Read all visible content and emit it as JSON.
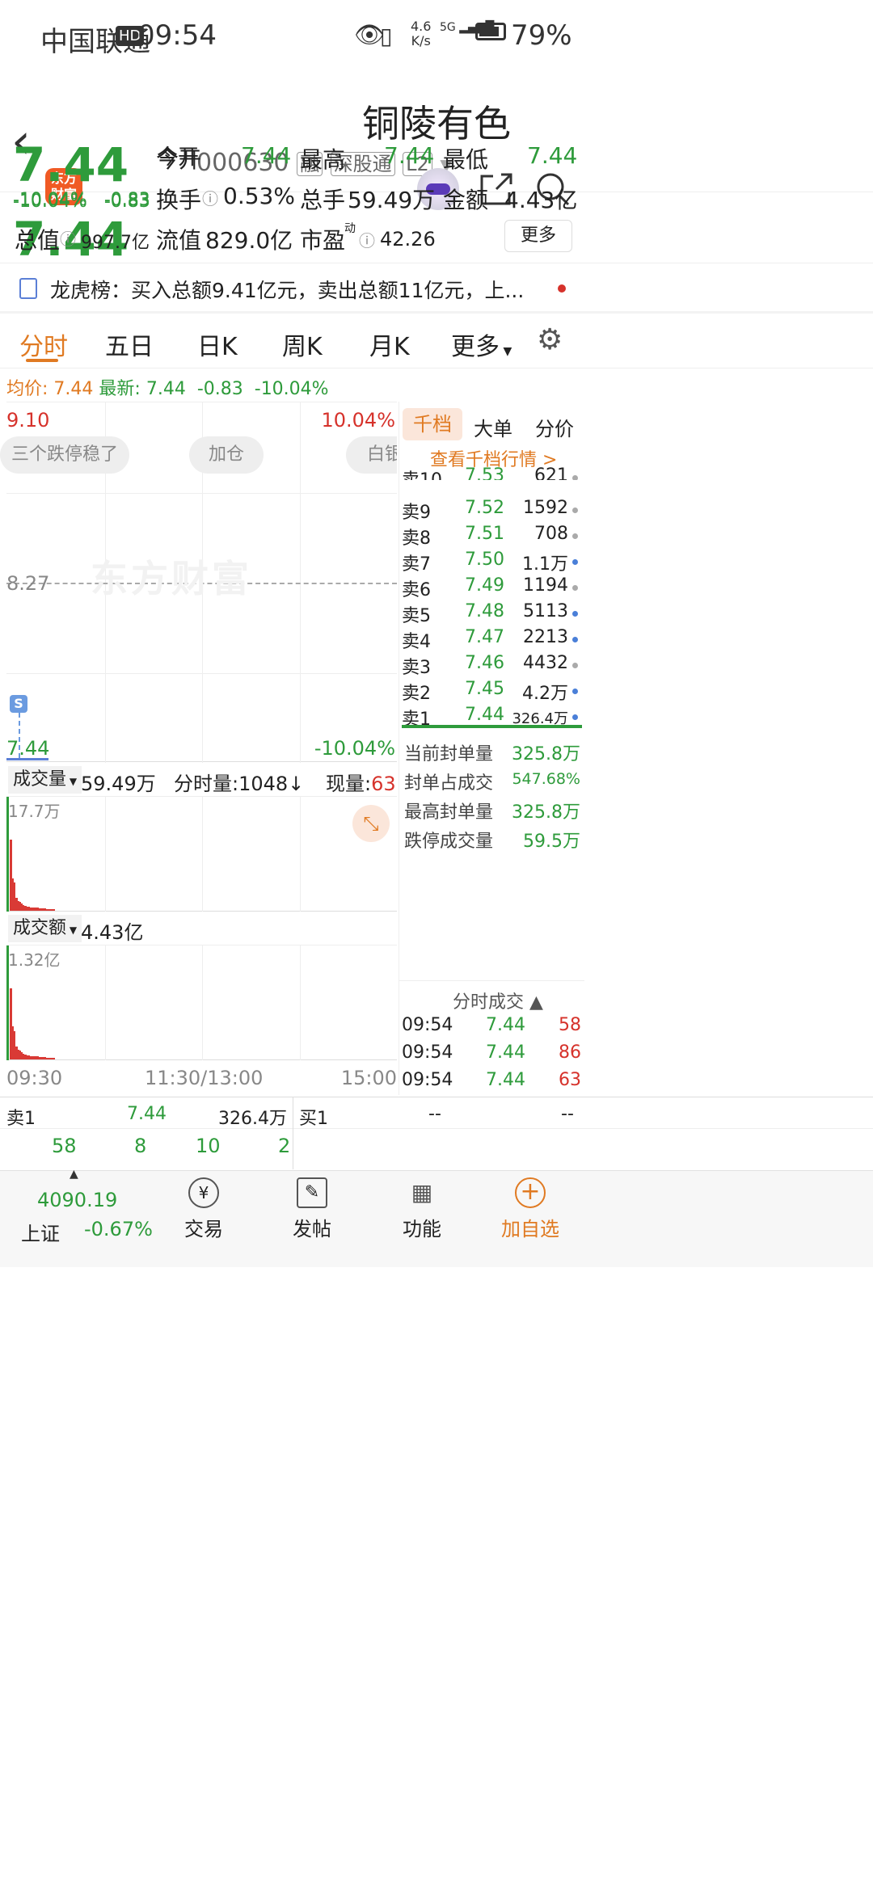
{
  "status": {
    "carrier": "中国联通",
    "hd": "HD",
    "time": "09:54",
    "speed_top": "4.6",
    "speed_bottom": "K/s",
    "net": "5G",
    "battery": "79%"
  },
  "header": {
    "logo_line1": "东方",
    "logo_line2": "财富",
    "title": "铜陵有色",
    "code": "000630",
    "tag_rong": "融",
    "tag_sgt": "深股通",
    "tag_l2": "L2"
  },
  "quote": {
    "price": "7.44",
    "change_pct": "-10.04%",
    "change": "-0.83",
    "open_label": "今开",
    "open": "7.44",
    "high_label": "最高",
    "high": "7.44",
    "low_label": "最低",
    "low": "7.44",
    "turnover_label": "换手",
    "turnover": "0.53%",
    "vol_label": "总手",
    "vol": "59.49万",
    "amount_label": "金额",
    "amount": "4.43亿",
    "mktcap_label": "总值",
    "mktcap": "997.7亿",
    "float_label": "流值",
    "float": "829.0亿",
    "pe_label": "市盈",
    "pe_sup": "动",
    "pe": "42.26",
    "more": "更多"
  },
  "lhb": {
    "text": "龙虎榜：买入总额9.41亿元，卖出总额11亿元，上..."
  },
  "tabs": [
    "分时",
    "五日",
    "日K",
    "周K",
    "月K",
    "更多"
  ],
  "avgline": {
    "avg_label": "均价:",
    "avg": "7.44",
    "latest_label": "最新:",
    "latest": "7.44",
    "change": "-0.83",
    "pct": "-10.04%"
  },
  "chart": {
    "top_price": "9.10",
    "top_pct": "10.04%",
    "mid_price": "8.27",
    "bottom_price": "7.44",
    "bottom_pct": "-10.04%",
    "chips": [
      "三个跌停稳了",
      "加仓",
      "白银"
    ],
    "watermark": "东方财富",
    "signal": "S",
    "vol_label": "成交量",
    "vol_value": "59.49万",
    "fs_vol": "分时量:1048",
    "cur_vol_label": "现量:",
    "cur_vol": "63",
    "vol_max": "17.7万",
    "amt_label": "成交额",
    "amt_value": "4.43亿",
    "amt_max": "1.32亿",
    "x_start": "09:30",
    "x_mid": "11:30/13:00",
    "x_end": "15:00",
    "accent": "#e07a22",
    "up": "#d6322b",
    "down": "#2e9b3b"
  },
  "chart_data": {
    "type": "bar",
    "title": "分时成交量",
    "volume_bars_fraction": [
      1.0,
      0.46,
      0.4,
      0.18,
      0.14,
      0.12,
      0.1,
      0.08,
      0.07,
      0.06,
      0.06,
      0.05,
      0.05,
      0.04,
      0.04,
      0.04,
      0.03,
      0.03,
      0.03,
      0.03,
      0.02,
      0.02,
      0.02,
      0.02,
      0.02
    ],
    "amount_bars_fraction": [
      1.0,
      0.47,
      0.4,
      0.18,
      0.14,
      0.12,
      0.1,
      0.08,
      0.07,
      0.06,
      0.06,
      0.05,
      0.05,
      0.04,
      0.04,
      0.04,
      0.03,
      0.03,
      0.03,
      0.03,
      0.02,
      0.02,
      0.02,
      0.02,
      0.02
    ]
  },
  "orderbook": {
    "tabs": [
      "千档",
      "大单",
      "分价"
    ],
    "link": "查看千档行情 >",
    "rows": [
      {
        "label": "卖10",
        "price": "7.53",
        "vol": "621",
        "dot": "gray"
      },
      {
        "label": "卖9",
        "price": "7.52",
        "vol": "1592",
        "dot": "gray"
      },
      {
        "label": "卖8",
        "price": "7.51",
        "vol": "708",
        "dot": "gray"
      },
      {
        "label": "卖7",
        "price": "7.50",
        "vol": "1.1万",
        "dot": "blue"
      },
      {
        "label": "卖6",
        "price": "7.49",
        "vol": "1194",
        "dot": "gray"
      },
      {
        "label": "卖5",
        "price": "7.48",
        "vol": "5113",
        "dot": "blue"
      },
      {
        "label": "卖4",
        "price": "7.47",
        "vol": "2213",
        "dot": "blue"
      },
      {
        "label": "卖3",
        "price": "7.46",
        "vol": "4432",
        "dot": "gray"
      },
      {
        "label": "卖2",
        "price": "7.45",
        "vol": "4.2万",
        "dot": "blue"
      },
      {
        "label": "卖1",
        "price": "7.44",
        "vol": "326.4万",
        "dot": "blue"
      }
    ],
    "stats": [
      {
        "label": "当前封单量",
        "value": "325.8万"
      },
      {
        "label": "封单占成交",
        "value": "547.68%"
      },
      {
        "label": "最高封单量",
        "value": "325.8万"
      },
      {
        "label": "跌停成交量",
        "value": "59.5万"
      }
    ],
    "trades_title": "分时成交",
    "trades": [
      {
        "time": "09:54",
        "price": "7.44",
        "vol": "58"
      },
      {
        "time": "09:54",
        "price": "7.44",
        "vol": "86"
      },
      {
        "time": "09:54",
        "price": "7.44",
        "vol": "63"
      }
    ]
  },
  "bottombook": {
    "left_label": "卖1",
    "left_price": "7.44",
    "left_vol": "326.4万",
    "right_label": "买1",
    "right_price": "--",
    "right_vol": "--",
    "nums": [
      "58",
      "8",
      "10",
      "2"
    ]
  },
  "nav": {
    "index_value": "4090.19",
    "index_name": "上证",
    "index_pct": "-0.67%",
    "trade": "交易",
    "post": "发帖",
    "func": "功能",
    "add": "加自选"
  }
}
